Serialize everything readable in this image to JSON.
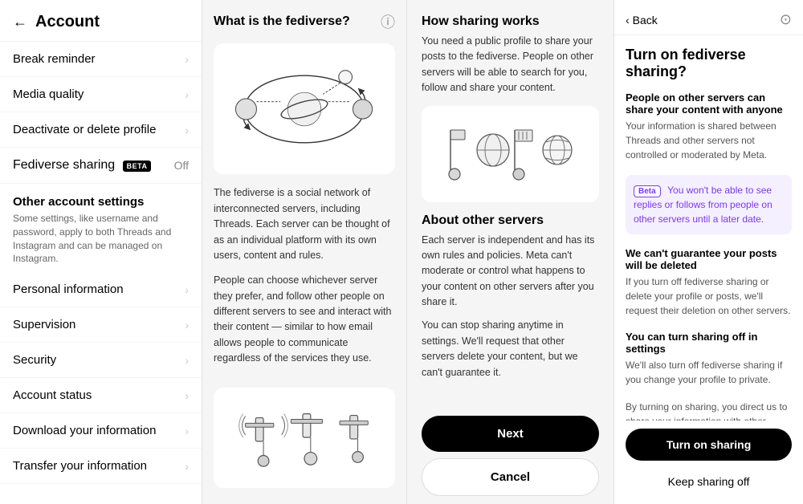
{
  "sidebar": {
    "back_label": "←",
    "title": "Account",
    "items": [
      {
        "id": "break-reminder",
        "label": "Break reminder",
        "value": "",
        "has_chevron": true
      },
      {
        "id": "media-quality",
        "label": "Media quality",
        "value": "",
        "has_chevron": true
      },
      {
        "id": "deactivate-delete",
        "label": "Deactivate or delete profile",
        "value": "",
        "has_chevron": true
      },
      {
        "id": "fediverse-sharing",
        "label": "Fediverse sharing",
        "badge": "BETA",
        "value": "Off",
        "has_chevron": false
      }
    ],
    "other_account": {
      "title": "Other account settings",
      "description": "Some settings, like username and password, apply to both Threads and Instagram and can be managed on Instagram."
    },
    "sub_items": [
      {
        "id": "personal-info",
        "label": "Personal information",
        "has_chevron": true
      },
      {
        "id": "supervision",
        "label": "Supervision",
        "has_chevron": true
      },
      {
        "id": "security",
        "label": "Security",
        "has_chevron": true
      },
      {
        "id": "account-status",
        "label": "Account status",
        "has_chevron": true
      },
      {
        "id": "download-info",
        "label": "Download your information",
        "has_chevron": true
      },
      {
        "id": "transfer-info",
        "label": "Transfer your information",
        "has_chevron": true
      }
    ]
  },
  "middle": {
    "title": "What is the fediverse?",
    "info_icon": "ℹ",
    "paragraphs": [
      "The fediverse is a social network of interconnected servers, including Threads. Each server can be thought of as an individual platform with its own users, content and rules.",
      "People can choose whichever server they prefer, and follow other people on different servers to see and interact with their content — similar to how email allows people to communicate regardless of the services they use."
    ]
  },
  "how_sharing": {
    "title": "How sharing works",
    "text": "You need a public profile to share your posts to the fediverse. People on other servers will be able to search for you, follow and share your content.",
    "about_title": "About other servers",
    "about_text1": "Each server is independent and has its own rules and policies. Meta can't moderate or control what happens to your content on other servers after you share it.",
    "about_text2": "You can stop sharing anytime in settings. We'll request that other servers delete your content, but we can't guarantee it.",
    "next_label": "Next",
    "cancel_label": "Cancel"
  },
  "turn_on": {
    "back_label": "Back",
    "title": "Turn on fediverse sharing?",
    "block1_title": "People on other servers can share your content with anyone",
    "block1_text": "Your information is shared between Threads and other servers not controlled or moderated by Meta.",
    "beta_label": "Beta",
    "beta_text": "You won't be able to see replies or follows from people on other servers until a later date.",
    "block2_title": "We can't guarantee your posts will be deleted",
    "block2_text": "If you turn off fediverse sharing or delete your profile or posts, we'll request their deletion on other servers.",
    "block3_title": "You can turn sharing off in settings",
    "block3_text": "We'll also turn off fediverse sharing if you change your profile to private.",
    "block4_text": "By turning on sharing, you direct us to share your information with other servers in the fediverse. Learn more in the Meta Privacy Policy, Threads Supplemental Privacy Policy, and Help Center.",
    "turn_on_label": "Turn on sharing",
    "keep_off_label": "Keep sharing off"
  },
  "icons": {
    "gear": "⚙",
    "chevron_right": "›",
    "chevron_left": "‹",
    "info": "ⓘ"
  }
}
